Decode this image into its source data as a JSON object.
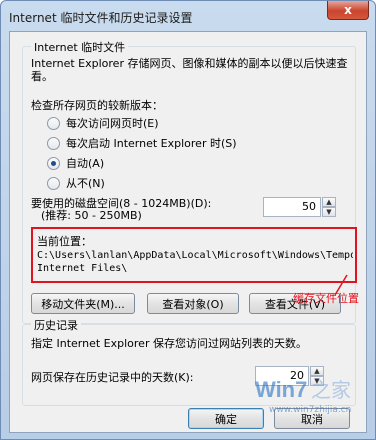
{
  "window": {
    "title": "Internet 临时文件和历史记录设置",
    "close_label": "x"
  },
  "temp_files": {
    "group_title": "Internet 临时文件",
    "description": "Internet Explorer 存储网页、图像和媒体的副本以便以后快速查看。",
    "check_label": "检查所存网页的较新版本：",
    "options": [
      {
        "label": "每次访问网页时(E)",
        "selected": false
      },
      {
        "label": "每次启动 Internet Explorer 时(S)",
        "selected": false
      },
      {
        "label": "自动(A)",
        "selected": true
      },
      {
        "label": "从不(N)",
        "selected": false
      }
    ],
    "disk_label_line1": "要使用的磁盘空间(8 - 1024MB)(D):",
    "disk_label_line2": "(推荐: 50 - 250MB)",
    "disk_value": "50",
    "location_title": "当前位置：",
    "location_path_line1": "C:\\Users\\lanlan\\AppData\\Local\\Microsoft\\Windows\\Temporary",
    "location_path_line2": "Internet Files\\",
    "buttons": {
      "move": "移动文件夹(M)...",
      "view_objects": "查看对象(O)",
      "view_files": "查看文件(V)"
    }
  },
  "annotation": {
    "text": "缓存文件位置",
    "color": "#e0141e"
  },
  "history": {
    "group_title": "历史记录",
    "description": "指定 Internet Explorer 保存您访问过网站列表的天数。",
    "days_label": "网页保存在历史记录中的天数(K):",
    "days_value": "20"
  },
  "footer": {
    "ok": "确定",
    "cancel": "取消"
  },
  "watermark": {
    "brand": "Win7之家",
    "url": "www.win7zhijia.cn"
  }
}
